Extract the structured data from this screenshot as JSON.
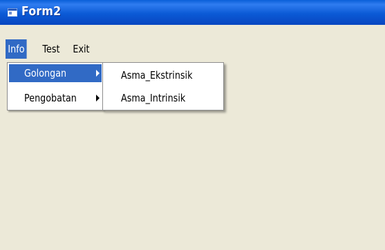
{
  "window": {
    "title": "Form2"
  },
  "menubar": {
    "items": [
      {
        "label": "Info",
        "active": true
      },
      {
        "label": "Test",
        "active": false
      },
      {
        "label": "Exit",
        "active": false
      }
    ]
  },
  "info_menu": {
    "items": [
      {
        "label": "Golongan",
        "highlighted": true,
        "has_submenu": true
      },
      {
        "label": "Pengobatan",
        "highlighted": false,
        "has_submenu": true
      }
    ]
  },
  "golongan_submenu": {
    "items": [
      {
        "label": "Asma_Ekstrinsik"
      },
      {
        "label": "Asma_Intrinsik"
      }
    ]
  },
  "colors": {
    "titlebar": "#0b5ad6",
    "highlight": "#316ac5",
    "face": "#ece9d8"
  },
  "icons": {
    "title": "app-window-icon",
    "submenu_arrow": "triangle-right-icon"
  }
}
